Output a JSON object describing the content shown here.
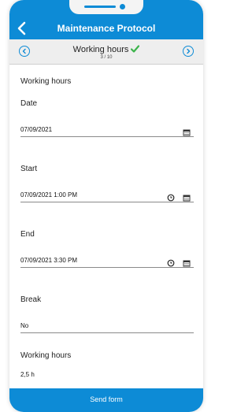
{
  "header": {
    "title": "Maintenance Protocol"
  },
  "stepper": {
    "step_title": "Working hours",
    "counter": "3 / 10"
  },
  "form": {
    "section_title": "Working hours",
    "date": {
      "label": "Date",
      "value": "07/09/2021"
    },
    "start": {
      "label": "Start",
      "value": "07/09/2021 1:00 PM"
    },
    "end": {
      "label": "End",
      "value": "07/09/2021 3:30 PM"
    },
    "break": {
      "label": "Break",
      "value": "No"
    },
    "working_hours": {
      "label": "Working hours",
      "value": "2,5 h"
    }
  },
  "footer": {
    "send_label": "Send form"
  },
  "colors": {
    "accent": "#0d8bd6",
    "check": "#3cb44b",
    "stepper_bg": "#eeeeee"
  }
}
